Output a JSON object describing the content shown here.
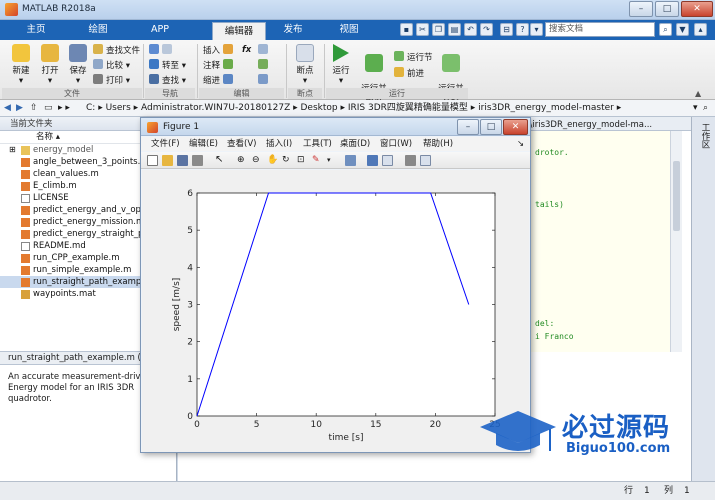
{
  "app": {
    "title": "MATLAB R2018a"
  },
  "window_buttons": {
    "minimize": "–",
    "maximize": "□",
    "close": "✕"
  },
  "tabs": [
    {
      "label": "主页"
    },
    {
      "label": "绘图"
    },
    {
      "label": "APP"
    },
    {
      "label": "编辑器"
    },
    {
      "label": "发布"
    },
    {
      "label": "视图"
    }
  ],
  "search": {
    "placeholder": "搜索文档"
  },
  "ribbon": {
    "file": {
      "new": "新建",
      "open": "打开",
      "save": "保存",
      "find_files": "查找文件",
      "compare": "比较",
      "print": "打印",
      "group": "文件"
    },
    "nav": {
      "goto": "转至",
      "find": "查找",
      "group": "导航"
    },
    "edit": {
      "insert": "插入",
      "comment": "注释",
      "indent": "缩进",
      "fx": "fx",
      "group": "编辑"
    },
    "breakpoints": {
      "label": "断点",
      "group": "断点"
    },
    "run": {
      "run": "运行",
      "run_advance": "运行并\n前进",
      "run_section": "运行节",
      "advance": "前进",
      "run_time": "运行并\n计时",
      "group": "运行"
    }
  },
  "address": {
    "path": [
      "C:",
      "Users",
      "Administrator.WIN7U-20180127Z",
      "Desktop",
      "IRIS 3DR四旋翼精确能量模型",
      "iris3DR_energy_model-master"
    ]
  },
  "left_panel": {
    "header": "当前文件夹",
    "column": "名称",
    "files": [
      {
        "name": "energy_model",
        "type": "folder"
      },
      {
        "name": "angle_between_3_points.m",
        "type": "m"
      },
      {
        "name": "clean_values.m",
        "type": "m"
      },
      {
        "name": "E_climb.m",
        "type": "m"
      },
      {
        "name": "LICENSE",
        "type": "file"
      },
      {
        "name": "predict_energy_and_v_opt.m",
        "type": "m"
      },
      {
        "name": "predict_energy_mission.m",
        "type": "m"
      },
      {
        "name": "predict_energy_straight_pa",
        "type": "m"
      },
      {
        "name": "README.md",
        "type": "file"
      },
      {
        "name": "run_CPP_example.m",
        "type": "m"
      },
      {
        "name": "run_simple_example.m",
        "type": "m"
      },
      {
        "name": "run_straight_path_example",
        "type": "m",
        "selected": true
      },
      {
        "name": "waypoints.mat",
        "type": "mat"
      }
    ],
    "details_title": "run_straight_path_example.m  (脚",
    "details_text": [
      "An accurate measurement-drive",
      "Energy model for an IRIS 3DR",
      "quadrotor."
    ]
  },
  "editor": {
    "path_tail": "型\\iris3DR_energy_model-ma...",
    "code_lines": [
      "drotor.",
      "tails)",
      "del:",
      "i Franco"
    ]
  },
  "right_strip": {
    "label": "工作区"
  },
  "status": {
    "row_label": "行",
    "row": "1",
    "col_label": "列",
    "col": "1"
  },
  "figure": {
    "title": "Figure 1",
    "menu": [
      "文件(F)",
      "编辑(E)",
      "查看(V)",
      "插入(I)",
      "工具(T)",
      "桌面(D)",
      "窗口(W)",
      "帮助(H)"
    ]
  },
  "chart_data": {
    "type": "line",
    "xlabel": "time [s]",
    "ylabel": "speed [m/s]",
    "xlim": [
      0,
      25
    ],
    "ylim": [
      0,
      6
    ],
    "xticks": [
      0,
      5,
      10,
      15,
      20,
      25
    ],
    "yticks": [
      0,
      1,
      2,
      3,
      4,
      5,
      6
    ],
    "series": [
      {
        "x": [
          0,
          6,
          19.6,
          22.8
        ],
        "y": [
          0,
          6,
          6,
          3
        ],
        "color": "#0000ff"
      }
    ],
    "grid": false
  },
  "watermark": {
    "title": "必过源码",
    "url": "Biguo100.com"
  }
}
